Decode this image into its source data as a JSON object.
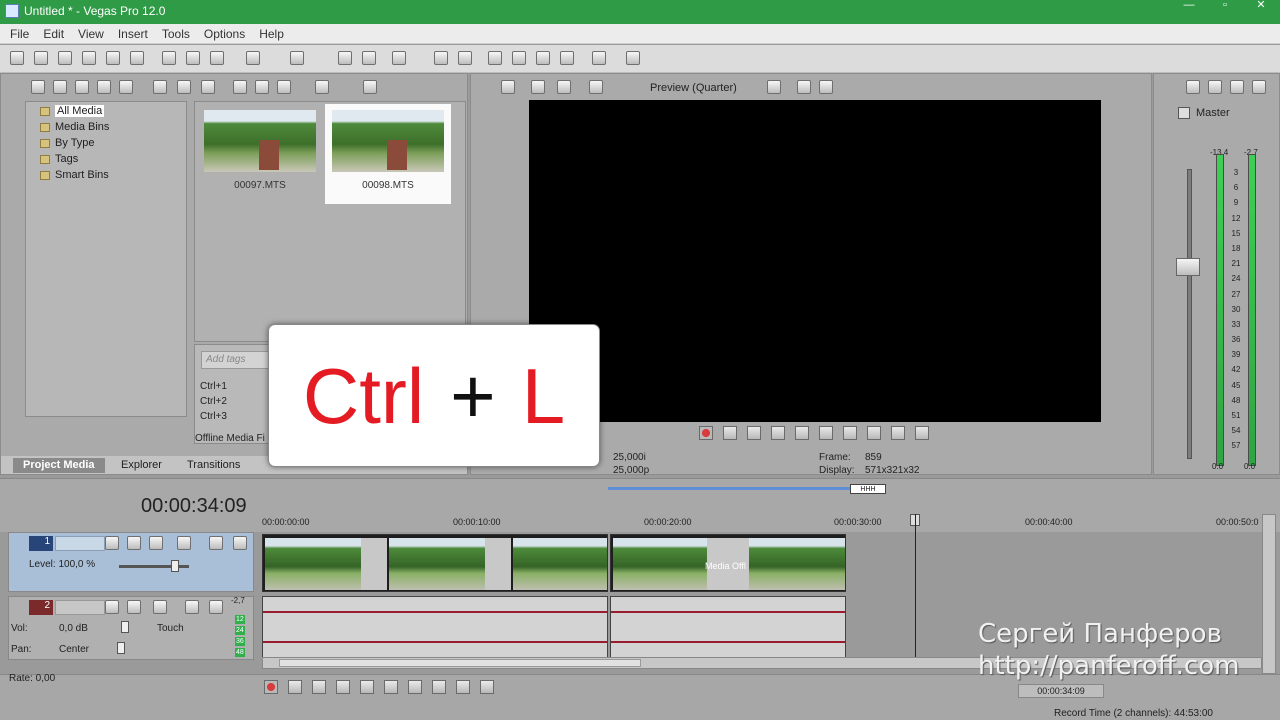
{
  "window": {
    "title": "Untitled * - Vegas Pro 12.0"
  },
  "menu": [
    "File",
    "Edit",
    "View",
    "Insert",
    "Tools",
    "Options",
    "Help"
  ],
  "project_media": {
    "tree": [
      "All Media",
      "Media Bins",
      "By Type",
      "Tags",
      "Smart Bins"
    ],
    "selected_tree_item": "All Media",
    "media": [
      {
        "name": "00097.MTS"
      },
      {
        "name": "00098.MTS"
      }
    ],
    "tag_placeholder": "Add tags",
    "shortcuts": [
      "Ctrl+1",
      "Ctrl+2",
      "Ctrl+3"
    ],
    "offline_label": "Offline Media Fi",
    "tabs": [
      "Project Media",
      "Explorer",
      "Transitions"
    ],
    "active_tab": "Project Media"
  },
  "preview": {
    "mode": "Preview (Quarter)",
    "info_left_1": "25,000i",
    "info_left_2": "25,000p",
    "frame_label": "Frame:",
    "frame_value": "859",
    "display_label": "Display:",
    "display_value": "571x321x32"
  },
  "mixer": {
    "master_label": "Master",
    "peak_left": "-13,4",
    "peak_right": "-2,7",
    "scale": [
      "3",
      "6",
      "9",
      "12",
      "15",
      "18",
      "21",
      "24",
      "27",
      "30",
      "33",
      "36",
      "39",
      "42",
      "45",
      "48",
      "51",
      "54",
      "57"
    ],
    "bottom_left": "0.0",
    "bottom_right": "0.0"
  },
  "timeline": {
    "timecode": "00:00:34:09",
    "overview_badge": "HHH",
    "ruler": [
      "00:00:00:00",
      "00:00:10:00",
      "00:00:20:00",
      "00:00:30:00",
      "00:00:40:00",
      "00:00:50:0"
    ],
    "video_track": {
      "number": "1",
      "level": "Level: 100,0 %"
    },
    "audio_track": {
      "number": "2",
      "peak": "-2,7",
      "vol_label": "Vol:",
      "vol_value": "0,0 dB",
      "pan_label": "Pan:",
      "pan_value": "Center",
      "automation": "Touch",
      "meter_scale": [
        "12",
        "24",
        "36",
        "48"
      ]
    },
    "offline_clip_text": "Media Offl",
    "rate": "Rate: 0,00",
    "bottom_time": "00:00:34:09",
    "record_time": "Record Time (2 channels): 44:53:00"
  },
  "overlay": {
    "key1": "Ctrl",
    "plus": "+",
    "key2": "L"
  },
  "watermark": {
    "name": "Сергей Панферов",
    "url": "http://panferoff.com"
  }
}
